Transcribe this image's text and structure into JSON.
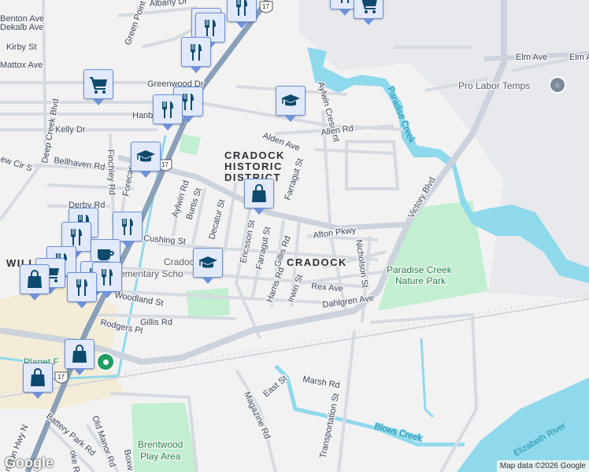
{
  "map": {
    "streets": {
      "benton": "Benton Ave",
      "dekalb": "Dekalb Ave",
      "kirby": "Kirby St",
      "mattox": "Mattox Ave",
      "greenpoint": "Green Point Dr",
      "albany": "Albany Dr",
      "greenwood": "Greenwood Dr",
      "hanbury": "Hanb",
      "kelly": "Kelly Dr",
      "deepcreek": "Deep Creek Blvd",
      "finchley": "Finchley Rd",
      "bellhaven": "Bellhaven Rd",
      "crewcir": "ew Cir S",
      "forecastle": "Forecas",
      "derby": "Derby Rd",
      "aylwinrd": "Aylwin Rd",
      "burtis": "Burtis St",
      "decatur": "Decatur St",
      "ericsson": "Ericsson St",
      "farragut1": "Farragut St",
      "farragut2": "Farragut St",
      "gillis": "Gillis Rd",
      "harris": "Harris Rd",
      "irwin": "Irwin St",
      "cushing": "Cushing St",
      "woodland": "Woodland St",
      "gillis2": "Gillis Rd",
      "rodgers": "Rodgers Pl",
      "alden": "Alden Ave",
      "aylwincrescent": "Aylwin Crescent",
      "allen": "Allen Rd",
      "afton": "Afton Pkwy",
      "nicholson": "Nicholson St",
      "rex": "Rex Ave",
      "dahlgren": "Dahlgren Ave",
      "victory": "Victory Blvd",
      "elm1": "Elm Ave",
      "elm2": "Elm Ave",
      "marsh": "Marsh Rd",
      "east": "East St",
      "magazine": "Magazine Rd",
      "transportation": "Transportation St",
      "battery": "Battery Park Rd",
      "oldmanor": "Old Manor Rd",
      "boxwood": "Boxw",
      "roanoke": "oke Rd",
      "gwhwy": "ngton Hwy N"
    },
    "areas": {
      "district_line1": "CRADOCK",
      "district_line2": "HISTORIC",
      "district_line3": "DISTRICT",
      "cradock": "CRADOCK",
      "williamson": "WILL"
    },
    "places": {
      "paradise_park_1": "Paradise Creek",
      "paradise_park_2": "Nature Park",
      "brentwood_1": "Brentwood",
      "brentwood_2": "Play Area",
      "cradock_school_1": "Cradoc",
      "cradock_school_2": "ementary Scho",
      "planet": "Planet F",
      "prolabor": "Pro Labor Temps"
    },
    "water": {
      "paradise_creek": "Paradise Creek",
      "blows_creek": "Blows Creek",
      "elizabeth": "Elizabeth River"
    },
    "shields": {
      "us17": "17"
    },
    "attribution": "Map data ©2026 Google",
    "logo": "Google"
  },
  "markers": {
    "icons": {
      "restaurant": "restaurant-icon",
      "grocery": "shopping-cart-icon",
      "school": "school-icon",
      "shopping": "shopping-bag-icon",
      "cafe": "coffee-cup-icon"
    }
  },
  "colors": {
    "water": "#8fd9ec",
    "park": "#c2efd2",
    "highway": "#8aa0b8",
    "marker_bg": "#e1e9fb",
    "marker_border": "#6f91d8",
    "marker_icon": "#0d4a6e"
  }
}
